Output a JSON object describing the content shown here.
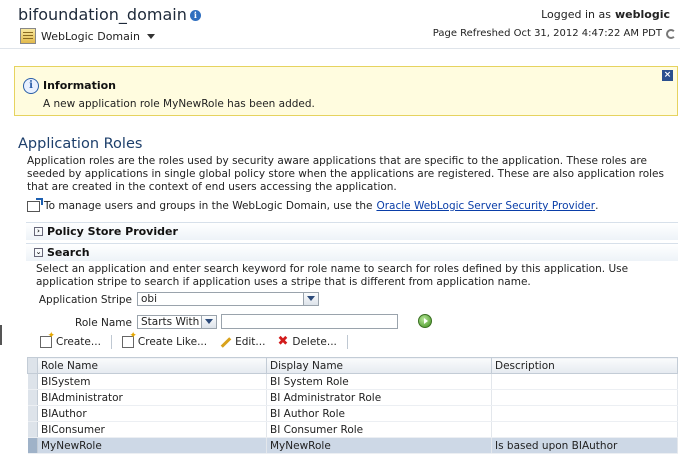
{
  "header": {
    "title": "bifoundation_domain",
    "domain_menu": "WebLogic Domain",
    "logged_in_label": "Logged in as",
    "user": "weblogic",
    "refreshed": "Page Refreshed Oct 31, 2012 4:47:22 AM PDT"
  },
  "info": {
    "title": "Information",
    "message": "A new application role MyNewRole has been added."
  },
  "page": {
    "title": "Application Roles",
    "description": "Application roles are the roles used by security aware applications that are specific to the application. These roles are seeded by applications in single global policy store when the applications are registered. These are also application roles that are created in the context of end users accessing the application.",
    "manage_text": "To manage users and groups in the WebLogic Domain, use the",
    "manage_link": "Oracle WebLogic Server Security Provider",
    "manage_end": "."
  },
  "sections": {
    "policy_store": "Policy Store Provider",
    "search": "Search"
  },
  "search": {
    "description": "Select an application and enter search keyword for role name to search for roles defined by this application. Use application stripe to search if application uses a stripe that is different from application name.",
    "stripe_label": "Application Stripe",
    "stripe_value": "obi",
    "role_label": "Role Name",
    "operator_value": "Starts With",
    "keyword_value": ""
  },
  "toolbar": {
    "create": "Create...",
    "create_like": "Create Like...",
    "edit": "Edit...",
    "delete": "Delete..."
  },
  "table": {
    "columns": [
      "Role Name",
      "Display Name",
      "Description"
    ],
    "rows": [
      [
        "BISystem",
        "BI System Role",
        ""
      ],
      [
        "BIAdministrator",
        "BI Administrator Role",
        ""
      ],
      [
        "BIAuthor",
        "BI Author Role",
        ""
      ],
      [
        "BIConsumer",
        "BI Consumer Role",
        ""
      ],
      [
        "MyNewRole",
        "MyNewRole",
        "Is based upon BIAuthor"
      ]
    ]
  }
}
